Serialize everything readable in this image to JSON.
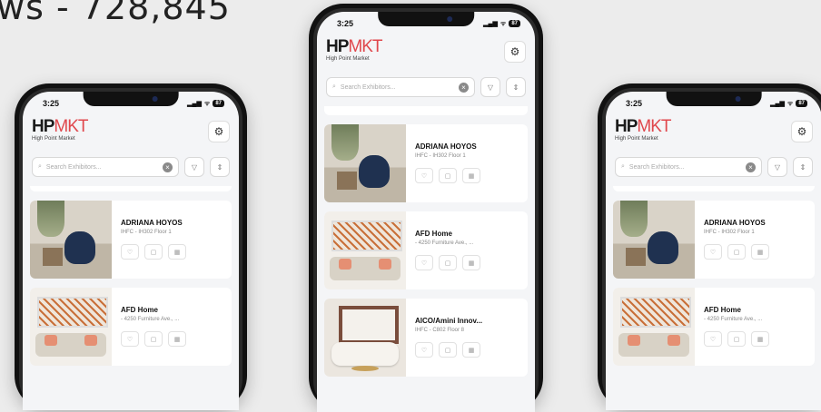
{
  "headline": "ws - 728,845",
  "status": {
    "time": "3:25",
    "signal": "▮▮▮",
    "wifi": "wifi",
    "battery": "87"
  },
  "app": {
    "logo_hp": "HP",
    "logo_mkt": "MKT",
    "logo_sub": "High Point Market",
    "settings_icon": "gear-icon"
  },
  "search": {
    "placeholder": "Search Exhibitors...",
    "filter_icon": "filter-icon",
    "sort_icon": "sort-icon"
  },
  "exhibitors": [
    {
      "name": "ADRIANA HOYOS",
      "location": "IHFC - IH302 Floor 1"
    },
    {
      "name": "AFD Home",
      "location": "- 4250 Furniture Ave., ..."
    },
    {
      "name": "AICO/Amini Innov...",
      "location": "IHFC - C802 Floor 8"
    }
  ],
  "actions": [
    "heart-icon",
    "note-icon",
    "calendar-icon"
  ]
}
